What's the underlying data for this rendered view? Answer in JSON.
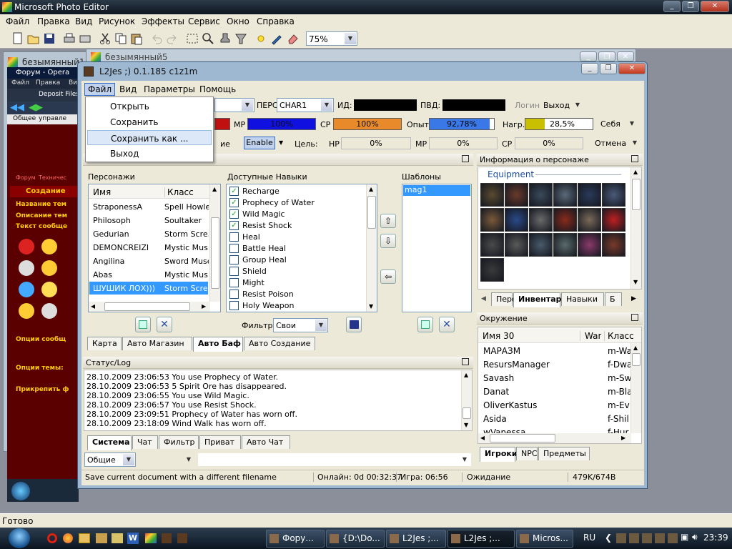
{
  "photo_editor": {
    "title": "Microsoft Photo Editor",
    "menu": [
      "Файл",
      "Правка",
      "Вид",
      "Рисунок",
      "Эффекты",
      "Сервис",
      "Окно",
      "Справка"
    ],
    "zoom": "75%",
    "status": "Готово",
    "doc1_title": "безымянный1",
    "doc5_title": "безымянный5"
  },
  "opera": {
    "title": "Форум - Opera",
    "menu": [
      "Файл",
      "Правка",
      "Вид"
    ],
    "tab": "Deposit Files",
    "nav_items": [
      "Общее",
      "управле"
    ],
    "forum_links": [
      "Форум",
      "Техничес"
    ],
    "heading": "Создание",
    "labels": [
      "Название тем",
      "Описание тем",
      "Текст сообще"
    ],
    "options": [
      "Опции сообщ",
      "Опции темы:",
      "Прикрепить ф"
    ]
  },
  "l2": {
    "title": "L2Jes ;) 0.1.185 c1z1m",
    "menu": [
      "Файл",
      "Вид",
      "Параметры",
      "Помощь"
    ],
    "file_menu": {
      "items": [
        "Открыть",
        "Сохранить",
        "Сохранить как ...",
        "Выход"
      ],
      "highlighted": 2
    },
    "row1": {
      "pers_label": "ПЕРС",
      "pers_value": "CHAR1",
      "id_label": "ИД:",
      "pvd_label": "ПВД:",
      "login": "Логин",
      "exit": "Выход"
    },
    "row2": {
      "mp_label": "МР",
      "mp_value": "100%",
      "cp_label": "СР",
      "cp_value": "100%",
      "exp_label": "Опыт",
      "exp_value": "92,78%",
      "load_label": "Нагр.",
      "load_value": "28,5%",
      "self": "Себя"
    },
    "row3": {
      "mode_partial": "ие",
      "enable": "Enable",
      "target_label": "Цель:",
      "hp_label": "НР",
      "hp_value": "0%",
      "mp_label": "МР",
      "mp_value": "0%",
      "cp_label": "СР",
      "cp_value": "0%",
      "cancel": "Отмена"
    },
    "colors": {
      "mp": "#1010e0",
      "cp": "#e07820",
      "exp": "#3a78e8",
      "load": "#c8c000",
      "selection": "#3399ff"
    },
    "chars": {
      "label": "Персонажи",
      "col_name": "Имя",
      "col_class": "Класс",
      "rows": [
        {
          "name": "StraponessA",
          "cls": "Spell Howle"
        },
        {
          "name": "Philosoph",
          "cls": "Soultaker"
        },
        {
          "name": "Gedurian",
          "cls": "Storm Scre."
        },
        {
          "name": "DEMONCREIZI",
          "cls": "Mystic Mus"
        },
        {
          "name": "Angilina",
          "cls": "Sword Muse"
        },
        {
          "name": "Abas",
          "cls": "Mystic Mus"
        },
        {
          "name": "ШУШИК ЛОХ)))",
          "cls": "Storm Scre."
        }
      ],
      "selected": 6
    },
    "skills": {
      "label": "Доступные Навыки",
      "items": [
        {
          "name": "Recharge",
          "checked": true
        },
        {
          "name": "Prophecy of Water",
          "checked": true
        },
        {
          "name": "Wild Magic",
          "checked": true
        },
        {
          "name": "Resist Shock",
          "checked": true
        },
        {
          "name": "Heal",
          "checked": false
        },
        {
          "name": "Battle Heal",
          "checked": false
        },
        {
          "name": "Group Heal",
          "checked": false
        },
        {
          "name": "Shield",
          "checked": false
        },
        {
          "name": "Might",
          "checked": false
        },
        {
          "name": "Resist Poison",
          "checked": false
        },
        {
          "name": "Holy Weapon",
          "checked": false
        }
      ],
      "filter_label": "Фильтр",
      "filter_value": "Свои"
    },
    "templates": {
      "label": "Шаблоны",
      "items": [
        "mag1"
      ]
    },
    "bottom_tabs": [
      "Карта",
      "Авто Магазин",
      "Авто Баф",
      "Авто Создание"
    ],
    "bottom_tab_selected": 2,
    "info": {
      "title": "Информация о персонаже",
      "group": "Equipment",
      "tabs": [
        "Перс",
        "Инвентарь",
        "Навыки",
        "Б"
      ],
      "selected_tab": 1
    },
    "log": {
      "title": "Статус/Log",
      "lines": [
        "28.10.2009 23:06:53 You use Prophecy of Water.",
        "28.10.2009 23:06:53 5 Spirit Ore has disappeared.",
        "28.10.2009 23:06:55 You use Wild Magic.",
        "28.10.2009 23:06:57 You use Resist Shock.",
        "28.10.2009 23:09:51 Prophecy of Water has worn off.",
        "28.10.2009 23:18:09 Wind Walk has worn off."
      ],
      "tabs": [
        "Система",
        "Чат",
        "Фильтр",
        "Приват",
        "Авто Чат"
      ],
      "selected_tab": 0,
      "chat_combo": "Общие"
    },
    "env": {
      "title": "Окружение",
      "col_name": "Имя 30",
      "col_war": "War",
      "col_class": "Класс",
      "rows": [
        {
          "name": "МАРАЗМ",
          "cls": "m-Wa"
        },
        {
          "name": "ResursManager",
          "cls": "f-Dwa"
        },
        {
          "name": "Savash",
          "cls": "m-Sw"
        },
        {
          "name": "Danat",
          "cls": "m-Bla"
        },
        {
          "name": "OliverKastus",
          "cls": "m-Ev"
        },
        {
          "name": "Asida",
          "cls": "f-Shil"
        },
        {
          "name": "wVanessa",
          "cls": "f-Hur"
        }
      ],
      "tabs": [
        "Игроки",
        "NPC",
        "Предметы"
      ],
      "selected_tab": 0
    },
    "status": {
      "hint": "Save current document with a different filename",
      "online": "Онлайн: 0d 00:32:37",
      "game": "Игра: 06:56",
      "state": "Ожидание",
      "traffic": "479K/674B"
    }
  },
  "taskbar": {
    "buttons": [
      "Фору...",
      "{D:\\Do...",
      "L2Jes ;...",
      "L2Jes ;...",
      "Micros..."
    ],
    "active": 3,
    "lang": "RU",
    "time": "23:39"
  }
}
